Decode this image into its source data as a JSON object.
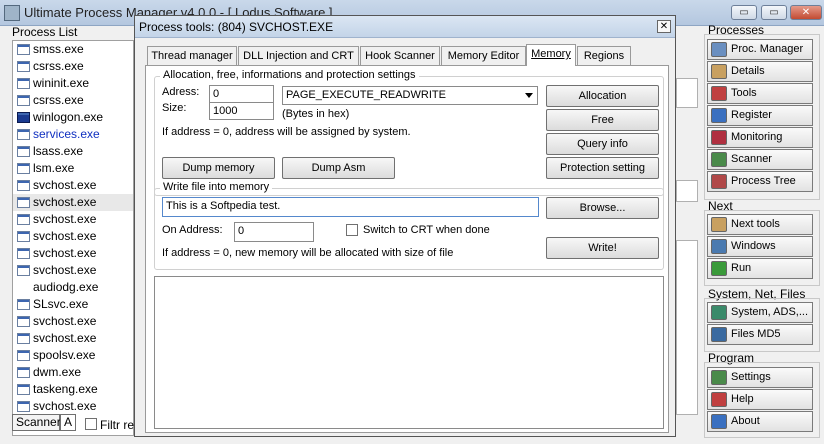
{
  "app": {
    "title": "Ultimate Process Manager v4.0.0 - [ Lodus Software ]",
    "btn_min": "▭",
    "btn_max": "▭",
    "btn_close": "✕"
  },
  "process_list": {
    "label": "Process List",
    "items": [
      {
        "name": "smss.exe"
      },
      {
        "name": "csrss.exe"
      },
      {
        "name": "wininit.exe"
      },
      {
        "name": "csrss.exe"
      },
      {
        "name": "winlogon.exe"
      },
      {
        "name": "services.exe"
      },
      {
        "name": "lsass.exe"
      },
      {
        "name": "lsm.exe"
      },
      {
        "name": "svchost.exe"
      },
      {
        "name": "svchost.exe"
      },
      {
        "name": "svchost.exe"
      },
      {
        "name": "svchost.exe"
      },
      {
        "name": "svchost.exe"
      },
      {
        "name": "svchost.exe"
      },
      {
        "name": "audiodg.exe"
      },
      {
        "name": "SLsvc.exe"
      },
      {
        "name": "svchost.exe"
      },
      {
        "name": "svchost.exe"
      },
      {
        "name": "spoolsv.exe"
      },
      {
        "name": "dwm.exe"
      },
      {
        "name": "taskeng.exe"
      },
      {
        "name": "svchost.exe"
      }
    ],
    "scanner_label": "Scanner",
    "a_label": "A",
    "filter_label": "Filtr reg"
  },
  "right_panel": {
    "processes_label": "Processes",
    "processes": [
      "Proc. Manager",
      "Details",
      "Tools",
      "Register",
      "Monitoring",
      "Scanner",
      "Process Tree"
    ],
    "next_label": "Next",
    "next": [
      "Next tools",
      "Windows",
      "Run"
    ],
    "sys_label": "System, Net, Files",
    "sys": [
      "System, ADS,...",
      "Files MD5"
    ],
    "program_label": "Program",
    "program": [
      "Settings",
      "Help",
      "About"
    ]
  },
  "dialog": {
    "title": "Process tools: (804) SVCHOST.EXE",
    "close": "✕",
    "tabs": [
      "Thread manager",
      "DLL Injection and CRT",
      "Hook Scanner",
      "Memory Editor",
      "Memory",
      "Regions"
    ],
    "alloc": {
      "legend": "Allocation, free, informations and protection settings",
      "adress_label": "Adress:",
      "adress_value": "0",
      "size_label": "Size:",
      "size_value": "1000",
      "protection": "PAGE_EXECUTE_READWRITE",
      "bytes_hint": "(Bytes in hex)",
      "note": "If address = 0, address will be assigned by system.",
      "allocation_btn": "Allocation",
      "free_btn": "Free",
      "query_btn": "Query info",
      "protection_btn": "Protection setting",
      "dump_memory_btn": "Dump memory",
      "dump_asm_btn": "Dump Asm"
    },
    "write": {
      "legend": "Write file into memory",
      "file_value": "This is a Softpedia test.",
      "browse_btn": "Browse...",
      "on_address_label": "On Address:",
      "on_address_value": "0",
      "switch_label": "Switch to CRT when done",
      "note": "If address = 0, new memory will be allocated with size of file",
      "write_btn": "Write!"
    }
  }
}
